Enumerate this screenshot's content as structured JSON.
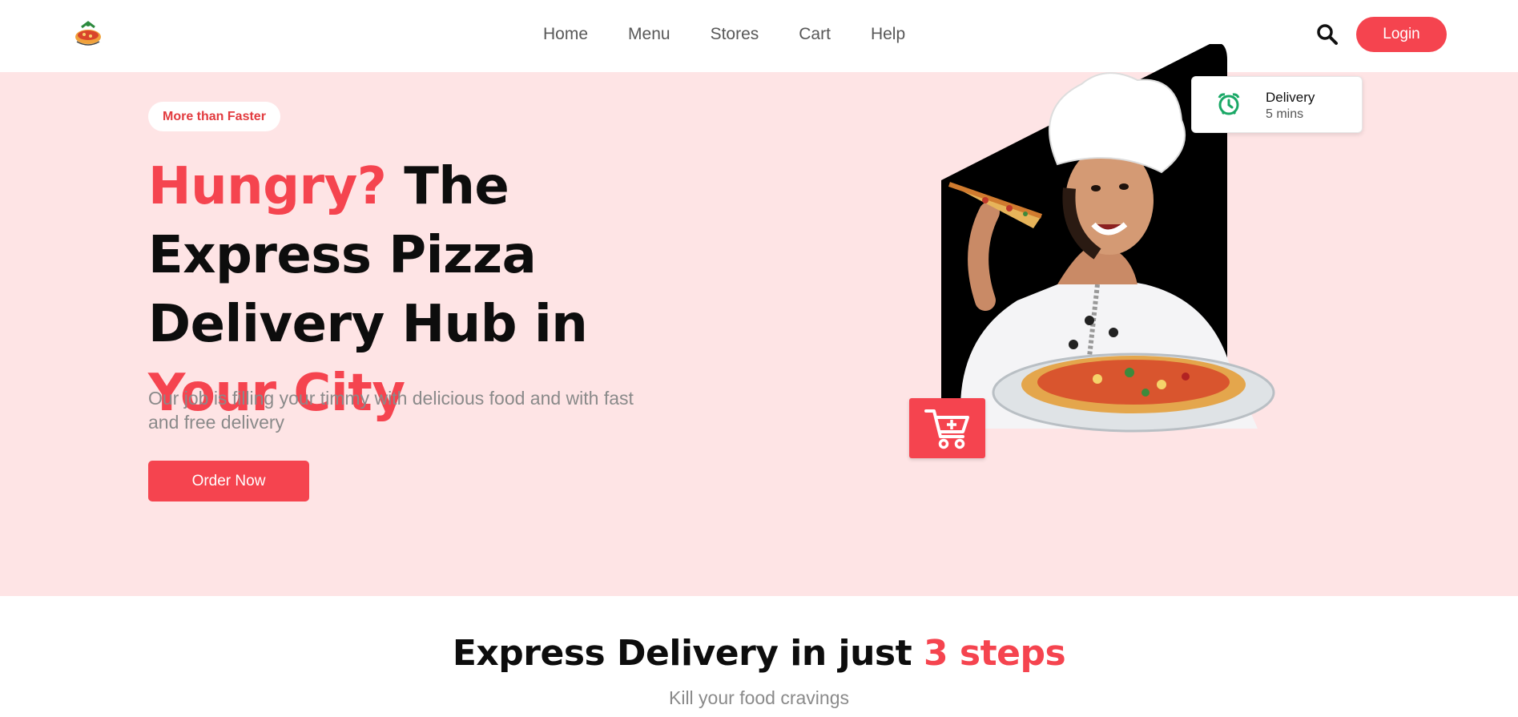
{
  "header": {
    "logo_icon": "pizza-logo-icon",
    "nav": [
      {
        "label": "Home"
      },
      {
        "label": "Menu"
      },
      {
        "label": "Stores"
      },
      {
        "label": "Cart"
      },
      {
        "label": "Help"
      }
    ],
    "search_icon": "search-icon",
    "login_label": "Login"
  },
  "hero": {
    "badge": "More than Faster",
    "headline": {
      "part1_accent": "Hungry?",
      "part2": " The Express Pizza Delivery Hub in ",
      "part3_accent": "Your City"
    },
    "subtext": "Our job is filling your timmy with delicious food and with fast and free delivery",
    "cta_label": "Order Now",
    "delivery_card": {
      "icon": "alarm-clock-icon",
      "title": "Delivery",
      "subtitle": "5 mins"
    },
    "cart_icon": "add-to-cart-icon"
  },
  "steps": {
    "title_part1": "Express Delivery in just ",
    "title_accent": "3 steps",
    "subtitle": "Kill your food cravings"
  },
  "colors": {
    "accent": "#f5444f",
    "hero_bg": "#fee4e5",
    "clock_green": "#1aa866"
  }
}
